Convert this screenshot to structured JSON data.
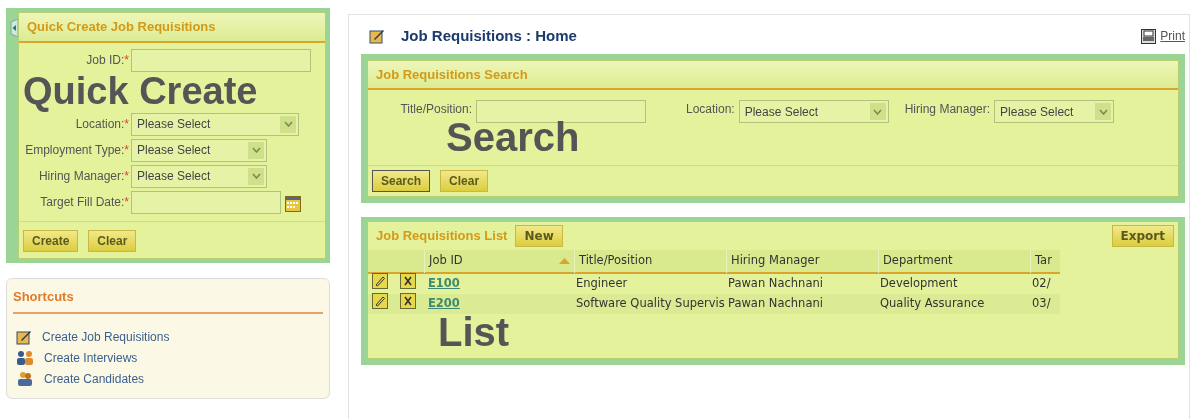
{
  "quick_create": {
    "title": "Quick Create Job Requisitions",
    "overlay_label": "Quick Create",
    "fields": [
      {
        "kind": "text",
        "label": "Job ID:",
        "required_mark": "*"
      },
      {
        "kind": "select",
        "label": "Location:",
        "required_mark": "*",
        "value": "Please Select"
      },
      {
        "kind": "select",
        "label": "Employment Type:",
        "required_mark": "*",
        "value": "Please Select"
      },
      {
        "kind": "select",
        "label": "Hiring Manager:",
        "required_mark": "*",
        "value": "Please Select"
      },
      {
        "kind": "date",
        "label": "Target Fill Date:",
        "required_mark": "*"
      }
    ],
    "buttons": [
      "Create",
      "Clear"
    ]
  },
  "shortcuts": {
    "title": "Shortcuts",
    "items": [
      {
        "label": "Create Job Requisitions",
        "kind": "edit"
      },
      {
        "label": "Create Interviews",
        "kind": "interview"
      },
      {
        "label": "Create Candidates",
        "kind": "candidates"
      }
    ]
  },
  "page": {
    "title": "Job Requisitions : Home",
    "print": "Print"
  },
  "search": {
    "title": "Job Requisitions Search",
    "overlay_label": "Search",
    "fields": [
      {
        "kind": "text",
        "label": "Title/Position:"
      },
      {
        "kind": "select",
        "label": "Location:",
        "value": "Please Select"
      },
      {
        "kind": "select",
        "label": "Hiring Manager:",
        "value": "Please Select"
      }
    ],
    "buttons": [
      "Search",
      "Clear"
    ]
  },
  "list": {
    "title": "Job Requisitions List",
    "new_button": "New",
    "export_button": "Export",
    "overlay_label": "List",
    "columns": [
      {
        "label": "Job ID",
        "sorted": true
      },
      {
        "label": "Title/Position"
      },
      {
        "label": "Hiring Manager"
      },
      {
        "label": "Department"
      },
      {
        "label": "Tar"
      }
    ],
    "rows": [
      {
        "job_id": "E100",
        "title": "Engineer",
        "manager": "Pawan Nachnani",
        "department": "Development",
        "column_5": "02/"
      },
      {
        "job_id": "E200",
        "title": "Software Quality Supervis",
        "manager": "Pawan Nachnani",
        "department": "Quality Assurance",
        "column_5": "03/"
      }
    ]
  }
}
